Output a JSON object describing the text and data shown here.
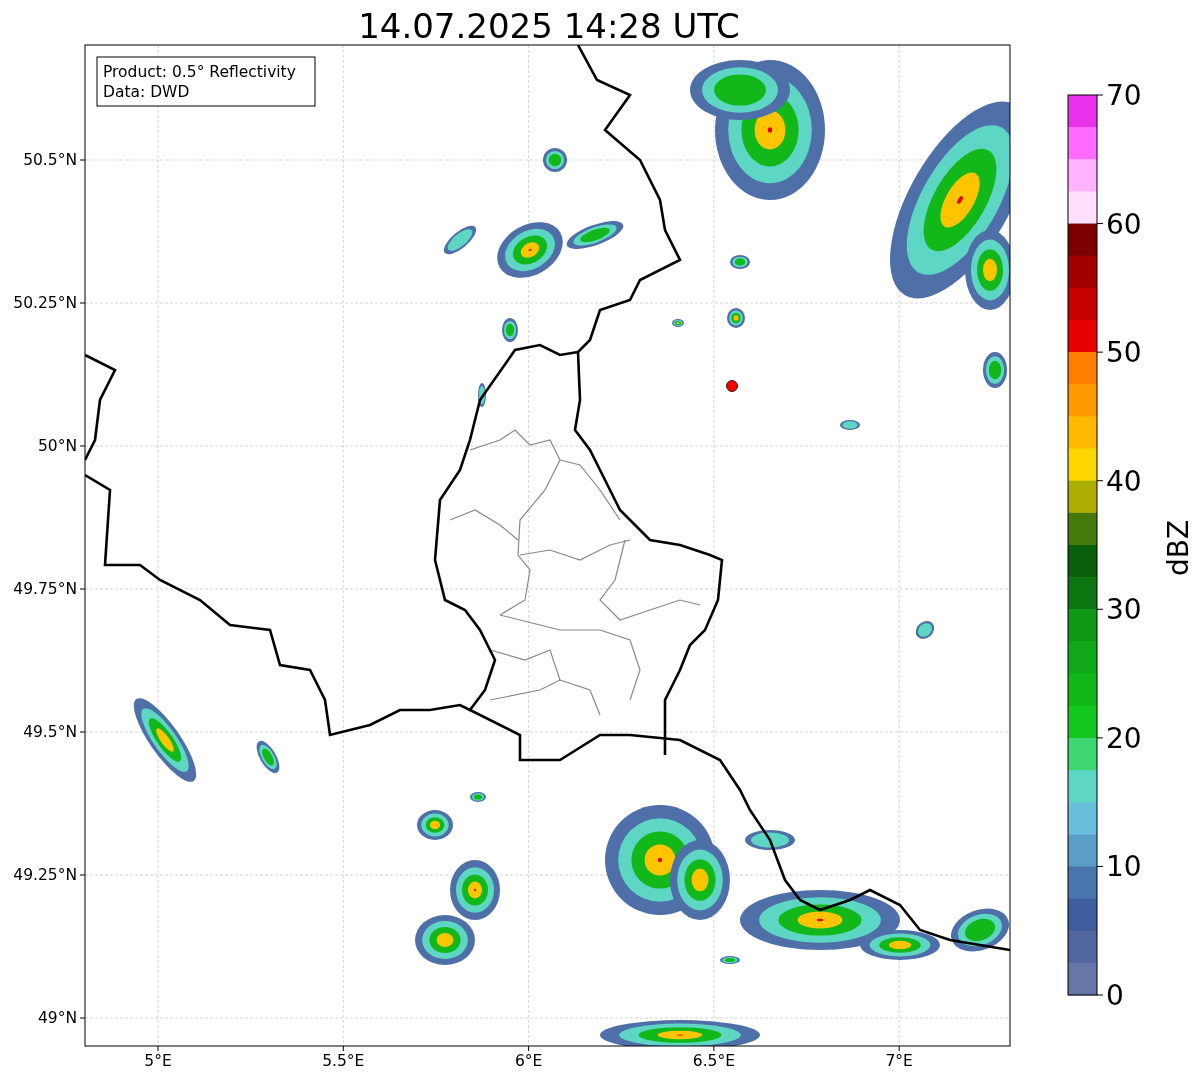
{
  "title": "14.07.2025 14:28 UTC",
  "map": {
    "legend": [
      "Product: 0.5° Reflectivity",
      "Data: DWD"
    ],
    "xticks": [
      "5°E",
      "5.5°E",
      "6°E",
      "6.5°E",
      "7°E"
    ],
    "yticks": [
      "50.5°N",
      "50.25°N",
      "50°N",
      "49.75°N",
      "49.5°N",
      "49.25°N",
      "49°N"
    ]
  },
  "colorbar": {
    "label": "dBZ",
    "ticks": [
      "70",
      "60",
      "50",
      "40",
      "30",
      "20",
      "10",
      "0"
    ],
    "bins": [
      {
        "color": "#ea32ea"
      },
      {
        "color": "#ff6bff"
      },
      {
        "color": "#ffb2ff"
      },
      {
        "color": "#ffe0ff"
      },
      {
        "color": "#7b0000"
      },
      {
        "color": "#a20000"
      },
      {
        "color": "#c40000"
      },
      {
        "color": "#e60000"
      },
      {
        "color": "#ff7f00"
      },
      {
        "color": "#ff9b00"
      },
      {
        "color": "#ffb900"
      },
      {
        "color": "#fed600"
      },
      {
        "color": "#acae04"
      },
      {
        "color": "#457a0a"
      },
      {
        "color": "#085e0b"
      },
      {
        "color": "#0b7510"
      },
      {
        "color": "#0f9716"
      },
      {
        "color": "#10a819"
      },
      {
        "color": "#12b81a"
      },
      {
        "color": "#12c71e"
      },
      {
        "color": "#3ed670"
      },
      {
        "color": "#5ed6c4"
      },
      {
        "color": "#68c0dc"
      },
      {
        "color": "#5a9dc6"
      },
      {
        "color": "#4a74ad"
      },
      {
        "color": "#3f5c9f"
      },
      {
        "color": "#52679e"
      },
      {
        "color": "#6676a8"
      }
    ]
  }
}
